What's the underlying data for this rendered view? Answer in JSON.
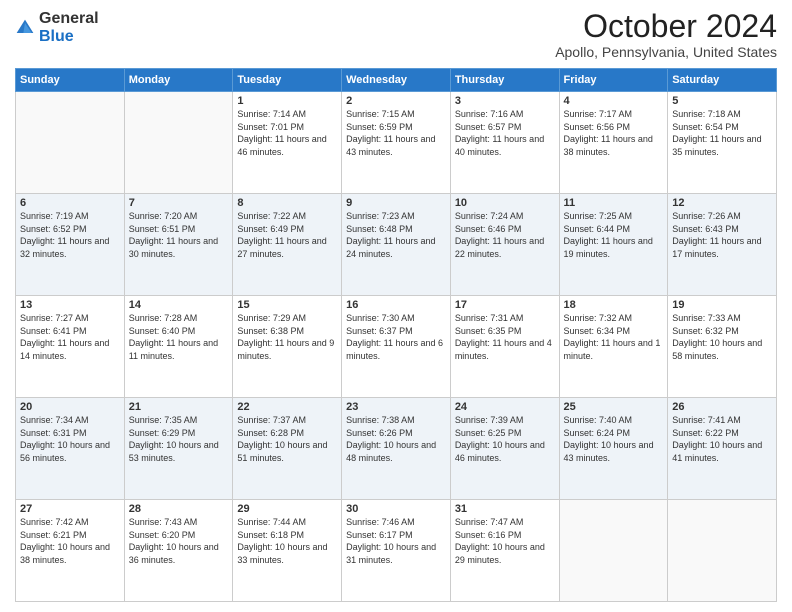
{
  "header": {
    "logo_general": "General",
    "logo_blue": "Blue",
    "month_title": "October 2024",
    "location": "Apollo, Pennsylvania, United States"
  },
  "weekdays": [
    "Sunday",
    "Monday",
    "Tuesday",
    "Wednesday",
    "Thursday",
    "Friday",
    "Saturday"
  ],
  "weeks": [
    [
      {
        "day": "",
        "info": ""
      },
      {
        "day": "",
        "info": ""
      },
      {
        "day": "1",
        "info": "Sunrise: 7:14 AM\nSunset: 7:01 PM\nDaylight: 11 hours and 46 minutes."
      },
      {
        "day": "2",
        "info": "Sunrise: 7:15 AM\nSunset: 6:59 PM\nDaylight: 11 hours and 43 minutes."
      },
      {
        "day": "3",
        "info": "Sunrise: 7:16 AM\nSunset: 6:57 PM\nDaylight: 11 hours and 40 minutes."
      },
      {
        "day": "4",
        "info": "Sunrise: 7:17 AM\nSunset: 6:56 PM\nDaylight: 11 hours and 38 minutes."
      },
      {
        "day": "5",
        "info": "Sunrise: 7:18 AM\nSunset: 6:54 PM\nDaylight: 11 hours and 35 minutes."
      }
    ],
    [
      {
        "day": "6",
        "info": "Sunrise: 7:19 AM\nSunset: 6:52 PM\nDaylight: 11 hours and 32 minutes."
      },
      {
        "day": "7",
        "info": "Sunrise: 7:20 AM\nSunset: 6:51 PM\nDaylight: 11 hours and 30 minutes."
      },
      {
        "day": "8",
        "info": "Sunrise: 7:22 AM\nSunset: 6:49 PM\nDaylight: 11 hours and 27 minutes."
      },
      {
        "day": "9",
        "info": "Sunrise: 7:23 AM\nSunset: 6:48 PM\nDaylight: 11 hours and 24 minutes."
      },
      {
        "day": "10",
        "info": "Sunrise: 7:24 AM\nSunset: 6:46 PM\nDaylight: 11 hours and 22 minutes."
      },
      {
        "day": "11",
        "info": "Sunrise: 7:25 AM\nSunset: 6:44 PM\nDaylight: 11 hours and 19 minutes."
      },
      {
        "day": "12",
        "info": "Sunrise: 7:26 AM\nSunset: 6:43 PM\nDaylight: 11 hours and 17 minutes."
      }
    ],
    [
      {
        "day": "13",
        "info": "Sunrise: 7:27 AM\nSunset: 6:41 PM\nDaylight: 11 hours and 14 minutes."
      },
      {
        "day": "14",
        "info": "Sunrise: 7:28 AM\nSunset: 6:40 PM\nDaylight: 11 hours and 11 minutes."
      },
      {
        "day": "15",
        "info": "Sunrise: 7:29 AM\nSunset: 6:38 PM\nDaylight: 11 hours and 9 minutes."
      },
      {
        "day": "16",
        "info": "Sunrise: 7:30 AM\nSunset: 6:37 PM\nDaylight: 11 hours and 6 minutes."
      },
      {
        "day": "17",
        "info": "Sunrise: 7:31 AM\nSunset: 6:35 PM\nDaylight: 11 hours and 4 minutes."
      },
      {
        "day": "18",
        "info": "Sunrise: 7:32 AM\nSunset: 6:34 PM\nDaylight: 11 hours and 1 minute."
      },
      {
        "day": "19",
        "info": "Sunrise: 7:33 AM\nSunset: 6:32 PM\nDaylight: 10 hours and 58 minutes."
      }
    ],
    [
      {
        "day": "20",
        "info": "Sunrise: 7:34 AM\nSunset: 6:31 PM\nDaylight: 10 hours and 56 minutes."
      },
      {
        "day": "21",
        "info": "Sunrise: 7:35 AM\nSunset: 6:29 PM\nDaylight: 10 hours and 53 minutes."
      },
      {
        "day": "22",
        "info": "Sunrise: 7:37 AM\nSunset: 6:28 PM\nDaylight: 10 hours and 51 minutes."
      },
      {
        "day": "23",
        "info": "Sunrise: 7:38 AM\nSunset: 6:26 PM\nDaylight: 10 hours and 48 minutes."
      },
      {
        "day": "24",
        "info": "Sunrise: 7:39 AM\nSunset: 6:25 PM\nDaylight: 10 hours and 46 minutes."
      },
      {
        "day": "25",
        "info": "Sunrise: 7:40 AM\nSunset: 6:24 PM\nDaylight: 10 hours and 43 minutes."
      },
      {
        "day": "26",
        "info": "Sunrise: 7:41 AM\nSunset: 6:22 PM\nDaylight: 10 hours and 41 minutes."
      }
    ],
    [
      {
        "day": "27",
        "info": "Sunrise: 7:42 AM\nSunset: 6:21 PM\nDaylight: 10 hours and 38 minutes."
      },
      {
        "day": "28",
        "info": "Sunrise: 7:43 AM\nSunset: 6:20 PM\nDaylight: 10 hours and 36 minutes."
      },
      {
        "day": "29",
        "info": "Sunrise: 7:44 AM\nSunset: 6:18 PM\nDaylight: 10 hours and 33 minutes."
      },
      {
        "day": "30",
        "info": "Sunrise: 7:46 AM\nSunset: 6:17 PM\nDaylight: 10 hours and 31 minutes."
      },
      {
        "day": "31",
        "info": "Sunrise: 7:47 AM\nSunset: 6:16 PM\nDaylight: 10 hours and 29 minutes."
      },
      {
        "day": "",
        "info": ""
      },
      {
        "day": "",
        "info": ""
      }
    ]
  ]
}
